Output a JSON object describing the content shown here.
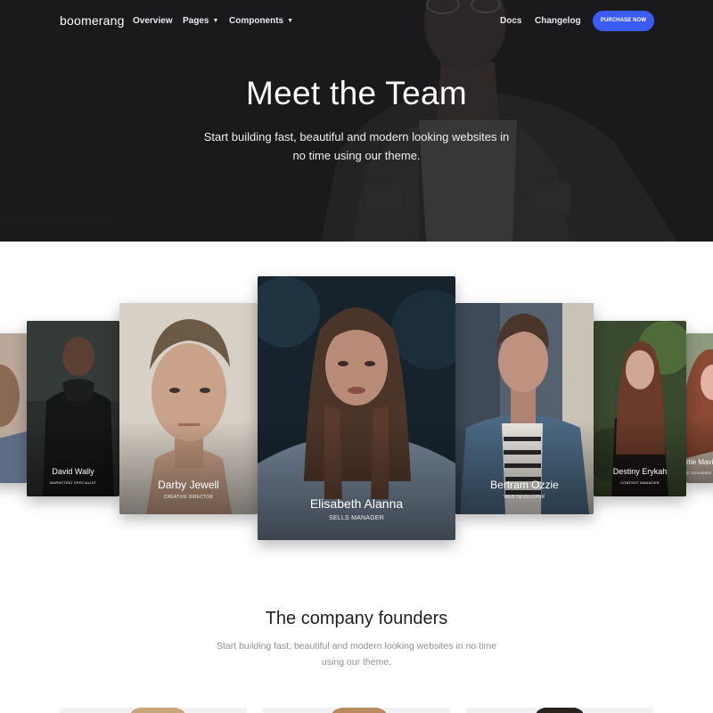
{
  "nav": {
    "brand": "boomerang",
    "items": [
      {
        "label": "Overview",
        "caret": false
      },
      {
        "label": "Pages",
        "caret": true
      },
      {
        "label": "Components",
        "caret": true
      }
    ],
    "right_items": [
      {
        "label": "Docs"
      },
      {
        "label": "Changelog"
      }
    ],
    "purchase_label": "PURCHASE NOW",
    "caret_icon": "chevron-down-icon"
  },
  "hero": {
    "title": "Meet the Team",
    "subtitle": "Start building fast, beautiful and modern looking websites in no time using our theme."
  },
  "team": [
    {
      "name": "",
      "role": ""
    },
    {
      "name": "David Wally",
      "role": "MARKETING SPECIALIST"
    },
    {
      "name": "Darby Jewell",
      "role": "CREATIVE DIRECTOR"
    },
    {
      "name": "Elisabeth Alanna",
      "role": "SELLS MANAGER"
    },
    {
      "name": "Bertram Ozzie",
      "role": "WEB DEVELOPER"
    },
    {
      "name": "Destiny Erykah",
      "role": "CONTENT MANAGER"
    },
    {
      "name": "rtie Mavi",
      "role": "IC DESIGNER"
    }
  ],
  "founders": {
    "title": "The company founders",
    "subtitle": "Start building fast, beautiful and modern looking websites in no time using our theme."
  },
  "colors": {
    "accent": "#3a5cf5",
    "hero_bg": "#1f1f21"
  }
}
